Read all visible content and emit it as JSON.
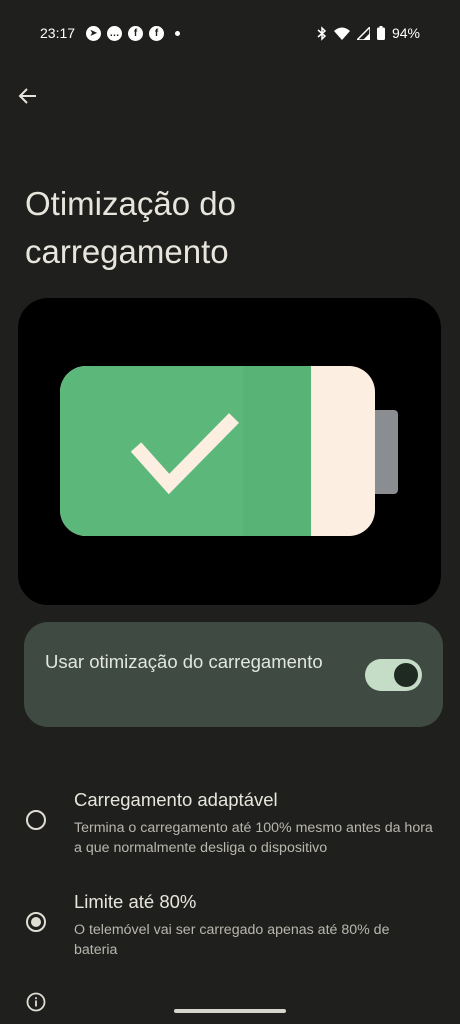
{
  "status_bar": {
    "time": "23:17",
    "notification_icons": [
      "telegram-icon",
      "chat-icon",
      "facebook-icon",
      "facebook-icon"
    ],
    "battery_percent": "94%"
  },
  "header": {
    "title": "Otimização do carregamento"
  },
  "toggle": {
    "label": "Usar otimização do carregamento",
    "enabled": true
  },
  "options": [
    {
      "title": "Carregamento adaptável",
      "description": "Termina o carregamento até 100% mesmo antes da hora a que normalmente desliga o dispositivo",
      "selected": false
    },
    {
      "title": "Limite até 80%",
      "description": "O telemóvel vai ser carregado apenas até 80% de bateria",
      "selected": true
    }
  ],
  "colors": {
    "background": "#1f201d",
    "card": "#3e4a42",
    "battery_green": "#5cb87a",
    "battery_shell": "#fdeee2"
  }
}
